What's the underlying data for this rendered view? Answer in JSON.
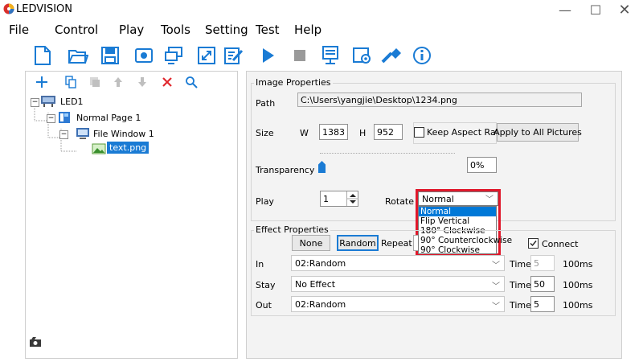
{
  "app": {
    "title": "LEDVISION",
    "window_controls": [
      "—",
      "☐",
      "✕"
    ]
  },
  "menu": [
    "File",
    "Control",
    "Play",
    "Tools",
    "Setting",
    "Test",
    "Help"
  ],
  "toolbar": {
    "icons": [
      "new-file-icon",
      "open-folder-icon",
      "save-icon",
      "preview-icon",
      "screen-send-icon",
      "fullscreen-icon",
      "edit-icon",
      "play-icon",
      "stop-icon",
      "monitor-icon",
      "settings-icon",
      "tools-icon",
      "info-icon"
    ]
  },
  "tree_toolbar": {
    "icons": [
      "add-icon",
      "copy-icon",
      "paste-icon",
      "move-up-icon",
      "move-down-icon",
      "delete-icon",
      "search-icon"
    ]
  },
  "tree": {
    "led": "LED1",
    "page": "Normal Page 1",
    "window": "File Window 1",
    "file": "text.png"
  },
  "image_properties": {
    "legend": "Image Properties",
    "path_label": "Path",
    "path_value": "C:\\Users\\yangjie\\Desktop\\1234.png",
    "size_label": "Size",
    "w_label": "W",
    "w_value": "1383",
    "h_label": "H",
    "h_value": "952",
    "keep_aspect_label": "Keep Aspect Ratio",
    "keep_aspect_checked": false,
    "apply_all_label": "Apply to All Pictures",
    "transparency_label": "Transparency",
    "transparency_value": "0%",
    "transparency_level": 0,
    "play_label": "Play",
    "play_value": "1",
    "rotate_label": "Rotate",
    "rotate_selected": "Normal",
    "rotate_options": [
      "Normal",
      "Flip Vertical",
      "180° Clockwise",
      "90° Counterclockwise",
      "90° Clockwise"
    ],
    "highlight_color": "#e0182b",
    "select_color": "#0078d7"
  },
  "effect_properties": {
    "legend": "Effect Properties",
    "none_label": "None",
    "random_label": "Random",
    "repeat_label": "Repeat",
    "connect_label": "Connect",
    "connect_checked": true,
    "in_label": "In",
    "in_value": "02:Random",
    "stay_label": "Stay",
    "stay_value": "No Effect",
    "out_label": "Out",
    "out_value": "02:Random",
    "time_label": "Time",
    "in_time": "5",
    "stay_time": "50",
    "out_time": "5",
    "unit": "100ms"
  }
}
